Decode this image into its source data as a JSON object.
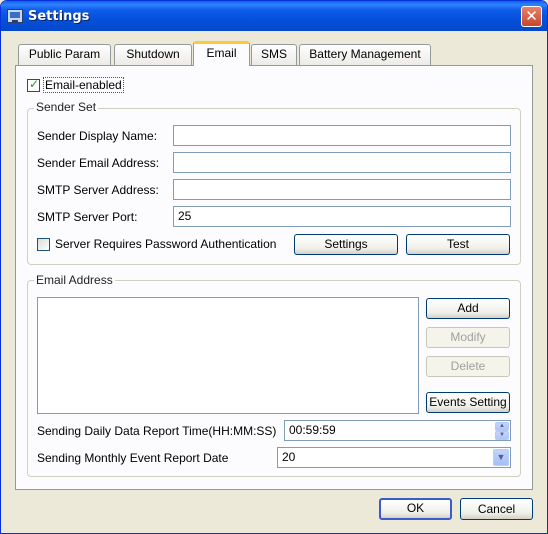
{
  "window": {
    "title": "Settings"
  },
  "tabs": [
    {
      "label": "Public Param"
    },
    {
      "label": "Shutdown"
    },
    {
      "label": "Email"
    },
    {
      "label": "SMS"
    },
    {
      "label": "Battery Management"
    }
  ],
  "active_tab": "Email",
  "email_enabled": {
    "label": "Email-enabled",
    "checked": true
  },
  "sender_set": {
    "title": "Sender Set",
    "display_name": {
      "label": "Sender Display Name:",
      "value": ""
    },
    "email_address": {
      "label": "Sender Email Address:",
      "value": ""
    },
    "smtp_address": {
      "label": "SMTP Server Address:",
      "value": ""
    },
    "smtp_port": {
      "label": "SMTP Server Port:",
      "value": "25"
    },
    "password_auth": {
      "label": "Server Requires Password Authentication",
      "checked": false
    },
    "settings_button": "Settings",
    "test_button": "Test"
  },
  "email_address": {
    "title": "Email Address",
    "list_items": [],
    "add_button": "Add",
    "modify_button": "Modify",
    "delete_button": "Delete",
    "events_button": "Events Setting",
    "daily_report": {
      "label": "Sending Daily Data Report Time(HH:MM:SS)",
      "value": "00:59:59"
    },
    "monthly_report": {
      "label": "Sending Monthly Event Report Date",
      "value": "20"
    }
  },
  "footer": {
    "ok": "OK",
    "cancel": "Cancel"
  }
}
